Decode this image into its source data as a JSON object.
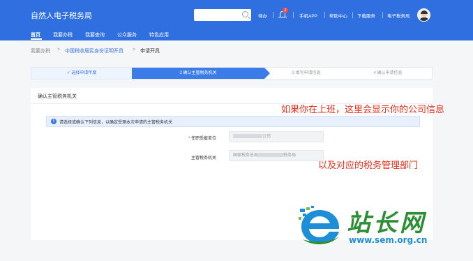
{
  "header": {
    "app_title": "自然人电子税务局",
    "links": [
      "待办",
      "手机APP",
      "帮助中心",
      "下载服务",
      "电子税务局"
    ],
    "notification_count": "2",
    "nav": [
      "首页",
      "我要办税",
      "我要查询",
      "公众服务",
      "特色应用"
    ]
  },
  "breadcrumb": {
    "items": [
      "我要办税",
      "中国税收居民身份证明开具",
      "申请开具"
    ]
  },
  "steps": [
    "✓ 选择申请年度",
    "2  确认主管税务机关",
    "3  填写申请信息",
    "4  确认申请信息"
  ],
  "panel": {
    "title": "确认主管税务机关",
    "info": "请选择或确认下列信息，以确定受理本次申请的主管税务机关",
    "form": {
      "employer_label": "任职受雇单位",
      "employer_value_suffix": "公司",
      "authority_label": "主管税务机关",
      "authority_value_prefix": "国家税务总局",
      "authority_value_suffix": "税务局"
    }
  },
  "annotations": {
    "note1": "如果你在上班，这里会显示你的公司信息",
    "note2": "以及对应的税务管理部门"
  },
  "watermark": {
    "title": "站长网",
    "url": "www.sem.org.cn"
  },
  "colors": {
    "primary": "#2f6fe0",
    "annotation": "#e8301c",
    "watermark_green": "#2d8f35",
    "watermark_blue": "#1e8fd6"
  }
}
